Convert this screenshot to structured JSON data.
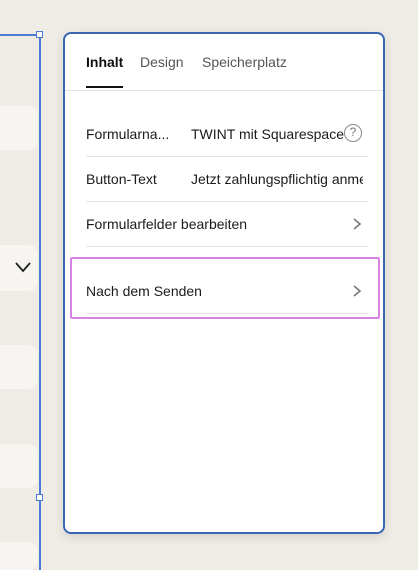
{
  "panel": {
    "tabs": [
      {
        "label": "Inhalt"
      },
      {
        "label": "Design"
      },
      {
        "label": "Speicherplatz"
      }
    ],
    "rows": [
      {
        "label": "Formularna...",
        "value": "TWINT mit Squarespace"
      },
      {
        "label": "Button-Text",
        "value": "Jetzt zahlungspflichtig anmelden"
      },
      {
        "label": "Formularfelder bearbeiten"
      },
      {
        "label": "Nach dem Senden"
      }
    ],
    "help_glyph": "?"
  },
  "colors": {
    "selection": "#4c7bd6",
    "panel_border": "#3a66b3",
    "highlight": "#d784e4"
  },
  "icons": [
    "chevron-down-icon",
    "help-icon",
    "chevron-right-icon"
  ]
}
